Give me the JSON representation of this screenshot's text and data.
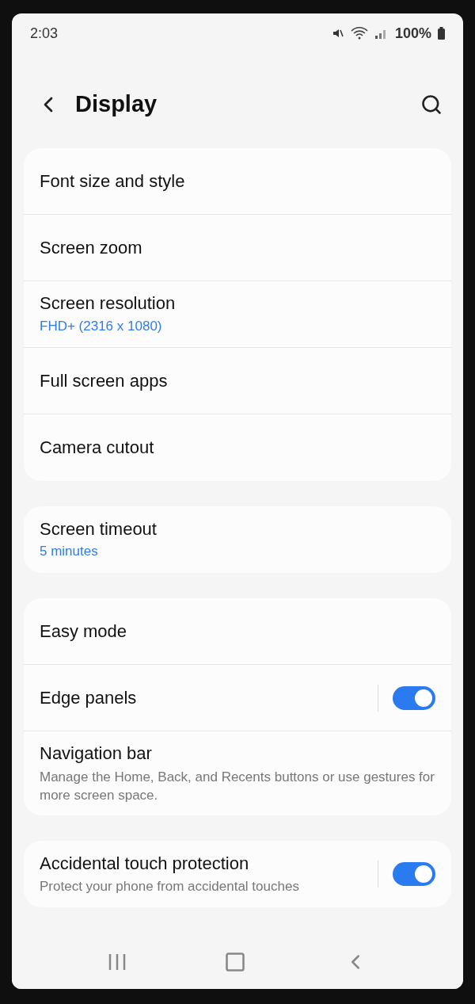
{
  "status_bar": {
    "time": "2:03",
    "battery": "100%"
  },
  "header": {
    "title": "Display"
  },
  "groups": [
    {
      "items": [
        {
          "kind": "link",
          "title": "Font size and style"
        },
        {
          "kind": "link",
          "title": "Screen zoom"
        },
        {
          "kind": "link",
          "title": "Screen resolution",
          "summary": "FHD+ (2316 x 1080)"
        },
        {
          "kind": "link",
          "title": "Full screen apps"
        },
        {
          "kind": "link",
          "title": "Camera cutout"
        }
      ]
    },
    {
      "items": [
        {
          "kind": "link",
          "title": "Screen timeout",
          "summary": "5 minutes"
        }
      ]
    },
    {
      "items": [
        {
          "kind": "link",
          "title": "Easy mode"
        },
        {
          "kind": "toggle",
          "title": "Edge panels",
          "on": true
        },
        {
          "kind": "link",
          "title": "Navigation bar",
          "description": "Manage the Home, Back, and Recents buttons or use gestures for more screen space."
        }
      ]
    },
    {
      "items": [
        {
          "kind": "toggle",
          "title": "Accidental touch protection",
          "description": "Protect your phone from accidental touches",
          "on": true
        }
      ]
    }
  ]
}
